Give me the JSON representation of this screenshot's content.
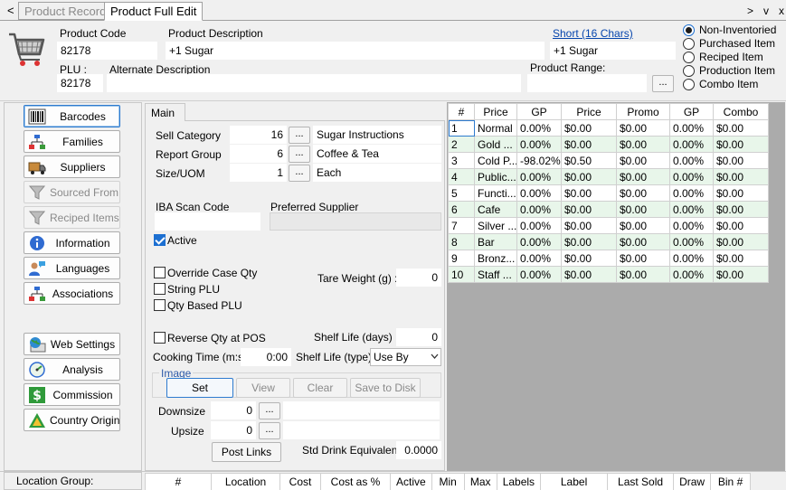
{
  "window": {
    "tabs": [
      "Product Records",
      "Product Full Edit"
    ],
    "back": "<",
    "right_controls": [
      ">",
      "v",
      "x"
    ]
  },
  "header": {
    "product_code_label": "Product Code",
    "product_code": "82178",
    "product_description_label": "Product Description",
    "product_description": "+1 Sugar",
    "short_link": "Short (16 Chars)",
    "short_value": "+1 Sugar",
    "plu_label": "PLU :",
    "plu": "82178",
    "alternate_description_label": "Alternate Description",
    "alternate_description": "",
    "product_range_label": "Product Range:",
    "product_range": "",
    "product_range_button": "...",
    "item_types": [
      {
        "label": "Non-Inventoried",
        "selected": true
      },
      {
        "label": "Purchased Item",
        "selected": false
      },
      {
        "label": "Reciped Item",
        "selected": false
      },
      {
        "label": "Production Item",
        "selected": false
      },
      {
        "label": "Combo Item",
        "selected": false
      }
    ]
  },
  "sidebar": {
    "items": [
      {
        "label": "Barcodes",
        "icon": "barcode-icon",
        "enabled": true,
        "active": true
      },
      {
        "label": "Families",
        "icon": "hierarchy-icon",
        "enabled": true
      },
      {
        "label": "Suppliers",
        "icon": "truck-icon",
        "enabled": true
      },
      {
        "label": "Sourced From",
        "icon": "funnel-icon",
        "enabled": false
      },
      {
        "label": "Reciped Items",
        "icon": "funnel-icon",
        "enabled": false
      },
      {
        "label": "Information",
        "icon": "info-icon",
        "enabled": true
      },
      {
        "label": "Languages",
        "icon": "person-speech-icon",
        "enabled": true
      },
      {
        "label": "Associations",
        "icon": "hierarchy-icon",
        "enabled": true
      },
      {
        "label": "Web Settings",
        "icon": "globe-icon",
        "enabled": true
      },
      {
        "label": "Analysis",
        "icon": "gauge-icon",
        "enabled": true
      },
      {
        "label": "Commission",
        "icon": "dollar-icon",
        "enabled": true
      },
      {
        "label": "Country Origin",
        "icon": "australia-icon",
        "enabled": true
      }
    ]
  },
  "main": {
    "tab": "Main",
    "sell_category_label": "Sell Category",
    "sell_category_num": "16",
    "sell_category_name": "Sugar Instructions",
    "report_group_label": "Report Group",
    "report_group_num": "6",
    "report_group_name": "Coffee & Tea",
    "size_uom_label": "Size/UOM",
    "size_uom_num": "1",
    "size_uom_name": "Each",
    "dots": "...",
    "iba_scan_code_label": "IBA Scan Code",
    "iba_scan_code": "",
    "preferred_supplier_label": "Preferred Supplier",
    "preferred_supplier": "",
    "active_label": "Active",
    "active": true,
    "override_case_qty_label": "Override Case Qty",
    "string_plu_label": "String PLU",
    "qty_based_plu_label": "Qty Based PLU",
    "tare_weight_label": "Tare Weight (g) :",
    "tare_weight": "0",
    "reverse_qty_label": "Reverse Qty at POS",
    "shelf_life_days_label": "Shelf Life (days) :",
    "shelf_life_days": "0",
    "cooking_time_label": "Cooking Time (m:s):",
    "cooking_time": "0:00",
    "shelf_life_type_label": "Shelf Life (type) :",
    "shelf_life_type": "Use By",
    "image_group_label": "Image",
    "image_buttons": [
      "Set",
      "View",
      "Clear",
      "Save to Disk"
    ],
    "downsize_label": "Downsize",
    "downsize": "0",
    "upsize_label": "Upsize",
    "upsize": "0",
    "post_links_label": "Post Links",
    "std_drink_label": "Std Drink Equivalent:",
    "std_drink": "0.0000"
  },
  "price_grid": {
    "headers": [
      "#",
      "Price",
      "GP",
      "Price",
      "Promo",
      "GP",
      "Combo"
    ],
    "rows": [
      [
        "1",
        "Normal",
        "0.00%",
        "$0.00",
        "$0.00",
        "0.00%",
        "$0.00"
      ],
      [
        "2",
        "Gold ...",
        "0.00%",
        "$0.00",
        "$0.00",
        "0.00%",
        "$0.00"
      ],
      [
        "3",
        "Cold P...",
        "-98.02%",
        "$0.50",
        "$0.00",
        "0.00%",
        "$0.00"
      ],
      [
        "4",
        "Public...",
        "0.00%",
        "$0.00",
        "$0.00",
        "0.00%",
        "$0.00"
      ],
      [
        "5",
        "Functi...",
        "0.00%",
        "$0.00",
        "$0.00",
        "0.00%",
        "$0.00"
      ],
      [
        "6",
        "Cafe",
        "0.00%",
        "$0.00",
        "$0.00",
        "0.00%",
        "$0.00"
      ],
      [
        "7",
        "Silver ...",
        "0.00%",
        "$0.00",
        "$0.00",
        "0.00%",
        "$0.00"
      ],
      [
        "8",
        "Bar",
        "0.00%",
        "$0.00",
        "$0.00",
        "0.00%",
        "$0.00"
      ],
      [
        "9",
        "Bronz...",
        "0.00%",
        "$0.00",
        "$0.00",
        "0.00%",
        "$0.00"
      ],
      [
        "10",
        "Staff ...",
        "0.00%",
        "$0.00",
        "$0.00",
        "0.00%",
        "$0.00"
      ]
    ]
  },
  "location": {
    "group_label": "Location Group:",
    "headers": [
      "#",
      "Location",
      "Cost",
      "Cost as %",
      "Active",
      "Min",
      "Max",
      "Labels",
      "Label",
      "Last Sold",
      "Draw",
      "Bin #"
    ]
  }
}
